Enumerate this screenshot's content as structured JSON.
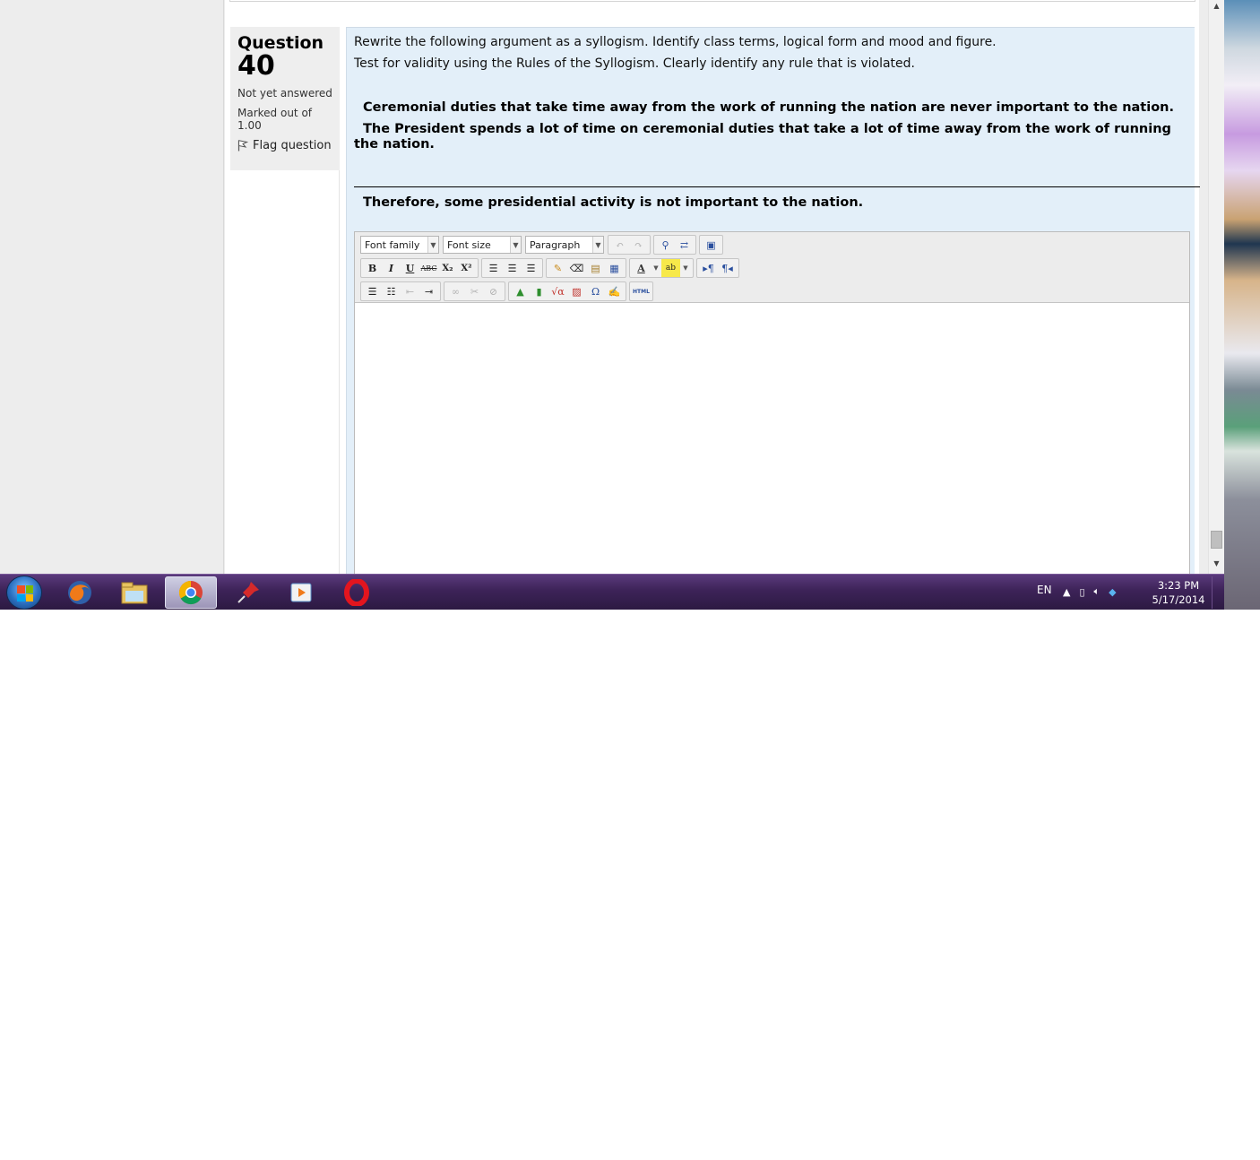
{
  "question": {
    "label": "Question",
    "number": "40",
    "status": "Not yet answered",
    "marked": "Marked out of 1.00",
    "flag_label": "Flag question",
    "prompt_line1": "Rewrite the following argument as a syllogism.  Identify class terms, logical form and mood and figure.",
    "prompt_line2": "Test for validity using the Rules of the Syllogism.  Clearly identify any rule that is violated.",
    "premise1": "Ceremonial duties that take time away from the work of running the nation are never important to the nation.",
    "premise2": "The President spends a lot of time on ceremonial duties that take a lot of time away from the work of running the nation.",
    "conclusion": "Therefore, some presidential activity is not important to the nation."
  },
  "editor": {
    "font_family": "Font family",
    "font_size": "Font size",
    "format": "Paragraph",
    "bold": "B",
    "italic": "I",
    "underline": "U",
    "strike": "ABC",
    "subscript": "X₂",
    "superscript": "X²",
    "omega": "Ω",
    "html": "HTML"
  },
  "taskbar": {
    "lang": "EN",
    "time": "3:23 PM",
    "date": "5/17/2014"
  },
  "colors": {
    "content_bg": "#e3eff9",
    "info_bg": "#eeeeee",
    "taskbar": "#3d2358"
  }
}
